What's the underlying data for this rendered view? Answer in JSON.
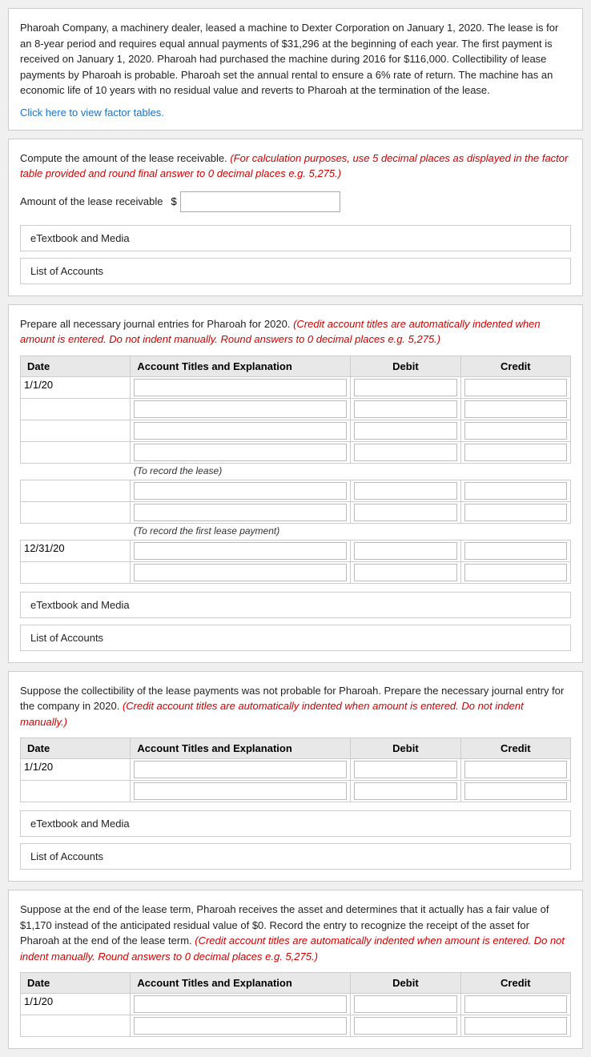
{
  "section1": {
    "description": "Pharoah Company, a machinery dealer, leased a machine to Dexter Corporation on January 1, 2020. The lease is for an 8-year period and requires equal annual payments of $31,296 at the beginning of each year. The first payment is received on January 1, 2020. Pharoah had purchased the machine during 2016 for $116,000. Collectibility of lease payments by Pharoah is probable. Pharoah set the annual rental to ensure a 6% rate of return. The machine has an economic life of 10 years with no residual value and reverts to Pharoah at the termination of the lease.",
    "link": "Click here to view factor tables."
  },
  "section2": {
    "instruction": "Compute the amount of the lease receivable.",
    "instruction_italic": "(For calculation purposes, use 5 decimal places as displayed in the factor table provided and round final answer to 0 decimal places e.g. 5,275.)",
    "amount_label": "Amount of the lease receivable",
    "dollar": "$",
    "etextbook_label": "eTextbook and Media",
    "list_of_accounts_label": "List of Accounts"
  },
  "section3": {
    "instruction": "Prepare all necessary journal entries for Pharoah for 2020.",
    "instruction_italic": "(Credit account titles are automatically indented when amount is entered. Do not indent manually. Round answers to 0 decimal places e.g. 5,275.)",
    "table": {
      "col_date": "Date",
      "col_account": "Account Titles and Explanation",
      "col_debit": "Debit",
      "col_credit": "Credit"
    },
    "rows": [
      {
        "date": "1/1/20",
        "note": null
      },
      {
        "date": "",
        "note": null
      },
      {
        "date": "",
        "note": null
      },
      {
        "date": "",
        "note": null
      },
      {
        "date": "",
        "note": "(To record the lease)"
      },
      {
        "date": "",
        "note": null
      },
      {
        "date": "",
        "note": null
      },
      {
        "date": "",
        "note": "(To record the first lease payment)"
      },
      {
        "date": "12/31/20",
        "note": null
      },
      {
        "date": "",
        "note": null
      }
    ],
    "etextbook_label": "eTextbook and Media",
    "list_of_accounts_label": "List of Accounts"
  },
  "section4": {
    "instruction": "Suppose the collectibility of the lease payments was not probable for Pharoah. Prepare the necessary journal entry for the company in 2020.",
    "instruction_italic": "(Credit account titles are automatically indented when amount is entered. Do not indent manually.)",
    "table": {
      "col_date": "Date",
      "col_account": "Account Titles and Explanation",
      "col_debit": "Debit",
      "col_credit": "Credit"
    },
    "etextbook_label": "eTextbook and Media",
    "list_of_accounts_label": "List of Accounts"
  },
  "section5": {
    "instruction": "Suppose at the end of the lease term, Pharoah receives the asset and determines that it actually has a fair value of $1,170 instead of the anticipated residual value of $0. Record the entry to recognize the receipt of the asset for Pharoah at the end of the lease term.",
    "instruction_italic": "(Credit account titles are automatically indented when amount is entered. Do not indent manually. Round answers to 0 decimal places e.g. 5,275.)",
    "table": {
      "col_date": "Date",
      "col_account": "Account Titles and Explanation",
      "col_debit": "Debit",
      "col_credit": "Credit"
    }
  }
}
